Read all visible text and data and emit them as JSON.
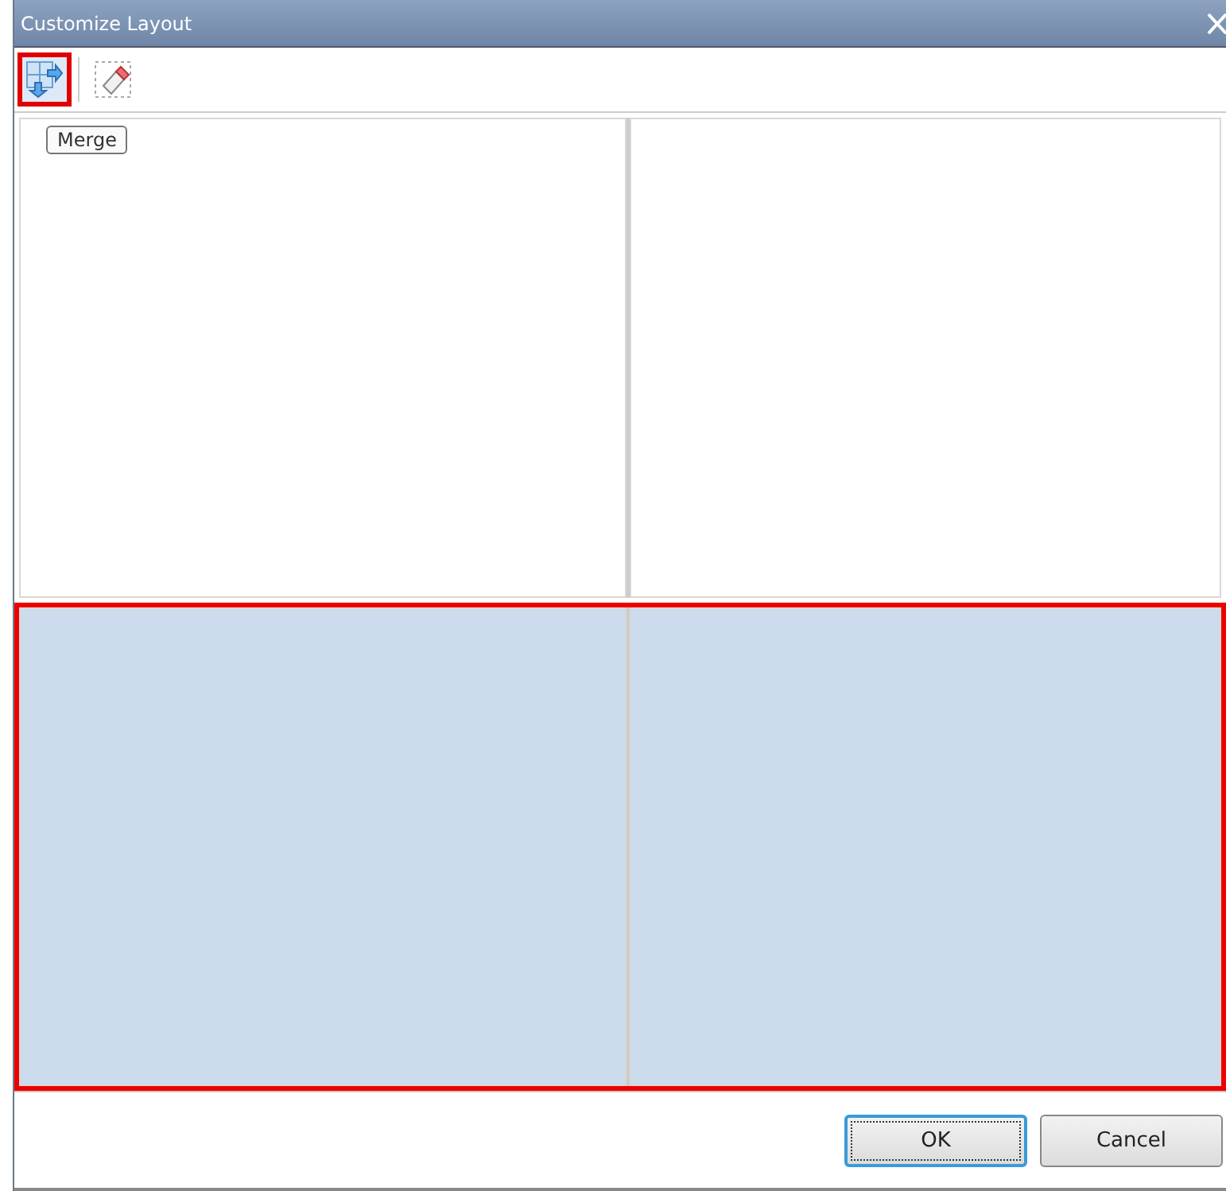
{
  "window": {
    "title": "Customize Layout"
  },
  "toolbar": [
    {
      "kind": "merge",
      "selected": true
    },
    {
      "kind": "erase",
      "selected": false
    }
  ],
  "tooltip": "Merge",
  "grid": {
    "rows": [
      {
        "cells": [
          {
            "selected": false
          },
          {
            "selected": false
          }
        ]
      },
      {
        "cells": [
          {
            "selected": true
          },
          {
            "selected": true
          }
        ]
      }
    ]
  },
  "buttons": [
    {
      "label": "OK",
      "default": true
    },
    {
      "label": "Cancel",
      "default": false
    }
  ]
}
